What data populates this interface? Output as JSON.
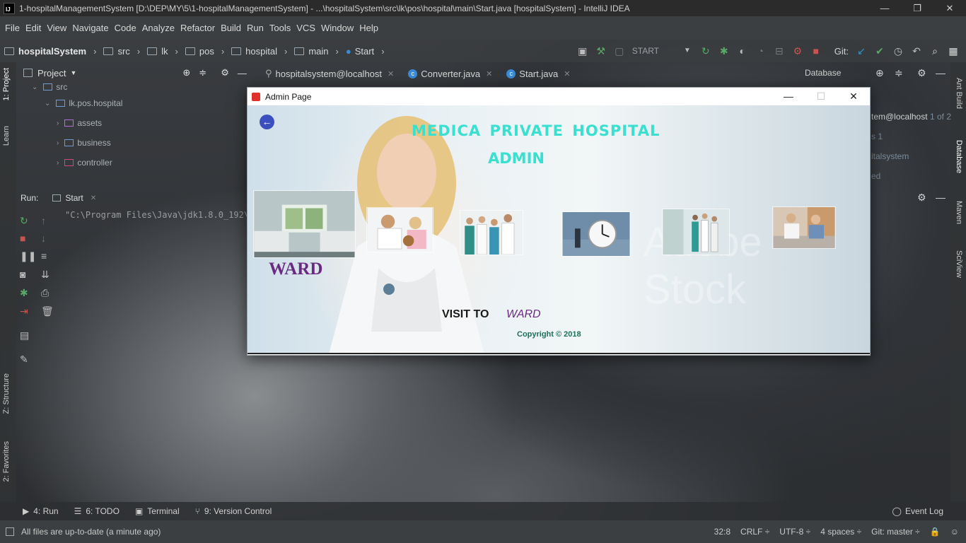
{
  "window": {
    "title": "1-hospitalManagementSystem [D:\\DEP\\MY\\5\\1-hospitalManagementSystem] - ...\\hospitalSystem\\src\\lk\\pos\\hospital\\main\\Start.java [hospitalSystem] - IntelliJ IDEA",
    "minimize": "—",
    "restore": "❐",
    "close": "✕"
  },
  "menu": [
    "File",
    "Edit",
    "View",
    "Navigate",
    "Code",
    "Analyze",
    "Refactor",
    "Build",
    "Run",
    "Tools",
    "VCS",
    "Window",
    "Help"
  ],
  "breadcrumb": {
    "project": "hospitalSystem",
    "items": [
      "src",
      "lk",
      "pos",
      "hospital",
      "main",
      "Start"
    ]
  },
  "toolbar": {
    "run_config": "START",
    "git_label": "Git:"
  },
  "left_strip": {
    "project_tab": "1: Project",
    "learn_tab": "Learn",
    "structure_tab": "Z: Structure",
    "favorites_tab": "2: Favorites"
  },
  "right_strip": {
    "ant_tab": "Ant Build",
    "database_tab": "Database",
    "maven_tab": "Maven",
    "sciview_tab": "SciView"
  },
  "project_panel": {
    "title": "Project",
    "tree": [
      {
        "label": "src",
        "indent": 0
      },
      {
        "label": "lk.pos.hospital",
        "indent": 1
      },
      {
        "label": "assets",
        "indent": 2
      },
      {
        "label": "business",
        "indent": 2
      },
      {
        "label": "controller",
        "indent": 2
      }
    ]
  },
  "editor_tabs": [
    {
      "label": "hospitalsystem@localhost"
    },
    {
      "label": "Converter.java"
    },
    {
      "label": "Start.java"
    }
  ],
  "database_panel": {
    "title": "Database",
    "fragments": [
      "tem@localhost",
      "1 of 2",
      "s 1",
      "italsystem",
      "ed"
    ]
  },
  "run_panel": {
    "label": "Run:",
    "config": "Start",
    "console_line": "\"C:\\Program Files\\Java\\jdk1.8.0_192\\b"
  },
  "admin_window": {
    "title": "Admin Page",
    "hospital_name": "MEDICA  PRIVATE  HOSPITAL",
    "role": "ADMIN",
    "section_label": "WARD",
    "visit_prefix": "VISIT TO",
    "visit_target": "WARD",
    "copyright": "Copyright © 2018",
    "watermark": "Adobe Stock",
    "thumbnails": [
      {
        "name": "ward-thumbnail"
      },
      {
        "name": "pediatric-thumbnail"
      },
      {
        "name": "doctors-thumbnail"
      },
      {
        "name": "clock-thumbnail"
      },
      {
        "name": "hallway-thumbnail"
      },
      {
        "name": "consultation-thumbnail"
      }
    ]
  },
  "bottom_tools": [
    {
      "label": "4: Run"
    },
    {
      "label": "6: TODO"
    },
    {
      "label": "Terminal"
    },
    {
      "label": "9: Version Control"
    }
  ],
  "event_log": "Event Log",
  "status": {
    "message": "All files are up-to-date (a minute ago)",
    "position": "32:8",
    "line_sep": "CRLF ÷",
    "encoding": "UTF-8 ÷",
    "indent": "4 spaces ÷",
    "git": "Git: master ÷"
  },
  "colors": {
    "accent_title": "#39e0cf",
    "ward_purple": "#6b2a82",
    "back_button": "#3b4fbf"
  }
}
